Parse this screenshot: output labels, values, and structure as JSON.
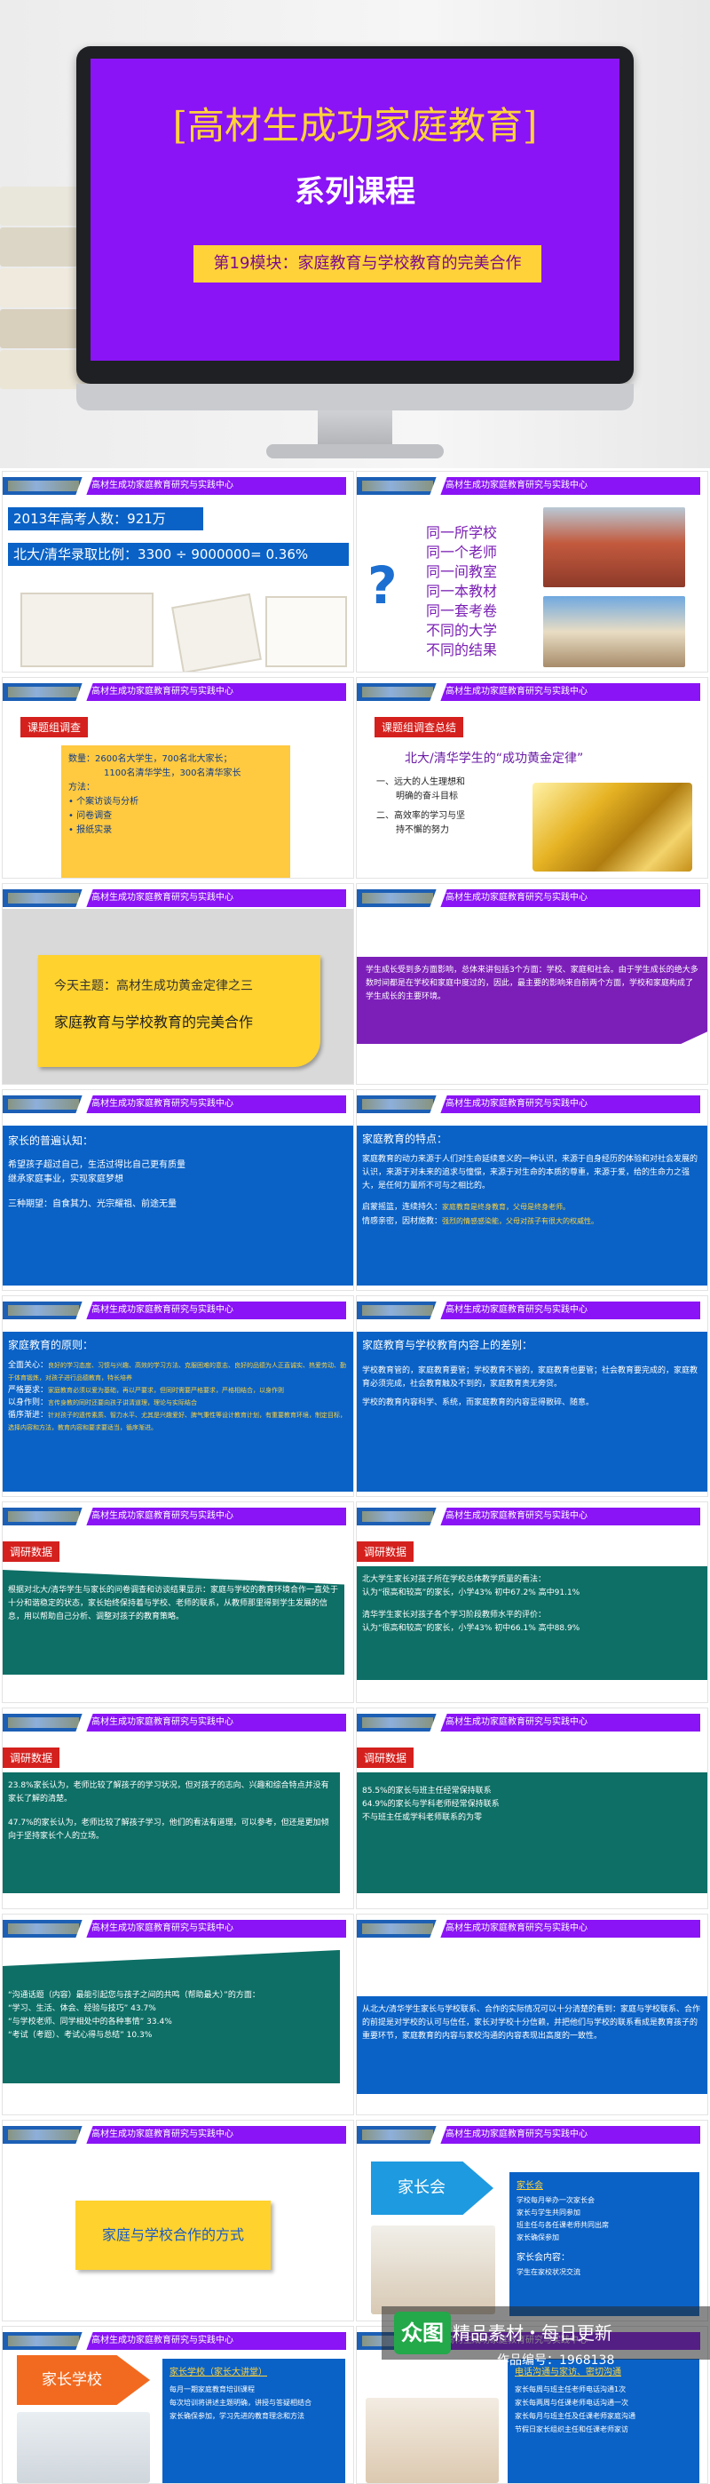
{
  "hero": {
    "title": "[高材生成功家庭教育]",
    "subtitle": "系列课程",
    "module": "第19模块：家庭教育与学校教育的完美合作"
  },
  "header_text": "高材生成功家庭教育研究与实践中心",
  "slide1": {
    "stat1": "2013年高考人数：921万",
    "stat2": "北大/清华录取比例：3300 ÷ 9000000= 0.36%"
  },
  "slide2": {
    "question_mark": "?",
    "lines": [
      "同一所学校",
      "同一个老师",
      "同一间教室",
      "同一本教材",
      "同一套考卷",
      "不同的大学",
      "不同的结果"
    ]
  },
  "slide3": {
    "tag": "课题组调查",
    "line1": "数量：2600名大学生，700名北大家长；",
    "line2": "1100名清华学生，300名清华家长",
    "method_label": "方法：",
    "methods": [
      "个案访谈与分析",
      "问卷调查",
      "报纸实录"
    ]
  },
  "slide4": {
    "tag": "课题组调查总结",
    "heading": "北大/清华学生的“成功黄金定律”",
    "item1_a": "一、远大的人生理想和",
    "item1_b": "明确的奋斗目标",
    "item2_a": "二、高效率的学习与坚",
    "item2_b": "持不懈的努力"
  },
  "slide5": {
    "line1": "今天主题：高材生成功黄金定律之三",
    "line2": "家庭教育与学校教育的完美合作"
  },
  "slide6": {
    "text": "学生成长受到多方面影响，总体来讲包括3个方面：学校、家庭和社会。由于学生成长的绝大多数时间都是在学校和家庭中度过的，因此，最主要的影响来自前两个方面，学校和家庭构成了学生成长的主要环境。"
  },
  "slide7": {
    "title": "家长的普遍认知：",
    "p1": "希望孩子超过自己，生活过得比自己更有质量",
    "p2": "继承家庭事业，实现家庭梦想",
    "p3": "三种期望：自食其力、光宗耀祖、前途无量"
  },
  "slide8": {
    "title": "家庭教育的特点：",
    "text": "家庭教育的动力来源于人们对生命延续意义的一种认识，来源于自身经历的体验和对社会发展的认识，来源于对未来的追求与憧憬，来源于对生命的本质的尊重，来源于爱，给的生命力之强大，是任何力量所不可与之相比的。",
    "k1_label": "启蒙摇篮，连续持久：",
    "k1_text": "家庭教育是终身教育，父母是终身老师。",
    "k2_label": "情感亲密，因材施教：",
    "k2_text": "强烈的情感感染能，父母对孩子有很大的权威性。"
  },
  "slide9": {
    "title": "家庭教育的原则：",
    "r1_label": "全面关心：",
    "r1_text": "良好的学习态度、习惯与兴趣、高效的学习方法、克服困难的意志、良好的品德为人正直诚实、热爱劳动、勤于体育锻炼，对孩子进行品德教育，特长培养",
    "r2_label": "严格要求：",
    "r2_text": "家庭教育必须以爱为基础，再以严要求，但同时需要严格要求，严格相结合，以身作则",
    "r3_label": "以身作则：",
    "r3_text": "言传身教的同时还要向孩子讲清道理，理论与实际结合",
    "r4_label": "循序渐进：",
    "r4_text": "针对孩子的遗传素质、智力水平、尤其是兴趣爱好、脾气秉性等设计教育计划，有重要教育环境，制定目标，选择内容和方法，教育内容和要求要适当，循序渐进。"
  },
  "slide10": {
    "title": "家庭教育与学校教育内容上的差别：",
    "p1": "学校教育管的，家庭教育要管；学校教育不管的，家庭教育也要管；社会教育要完成的，家庭教育必须完成，社会教育触及不到的，家庭教育责无旁贷。",
    "p2": "学校的教育内容科学、系统，而家庭教育的内容显得散碎、随意。"
  },
  "slide11": {
    "tag": "调研数据",
    "text": "根据对北大/清华学生与家长的问卷调查和访谈结果显示：家庭与学校的教育环境合作一直处于十分和谐稳定的状态，家长始终保持着与学校、老师的联系，从教师那里得到学生发展的信息，用以帮助自己分析、调整对孩子的教育策略。"
  },
  "slide12": {
    "tag": "调研数据",
    "p1": "北大学生家长对孩子所在学校总体教学质量的看法：",
    "p2": "认为“很高和较高”的家长，小学43% 初中67.2% 高中91.1%",
    "p3": "清华学生家长对孩子各个学习阶段教师水平的评价：",
    "p4": "认为“很高和较高”的家长，小学43% 初中66.1% 高中88.9%"
  },
  "slide13": {
    "tag": "调研数据",
    "p1": "23.8%家长认为，老师比较了解孩子的学习状况，但对孩子的志向、兴趣和综合特点并没有家长了解的清楚。",
    "p2": "47.7%的家长认为，老师比较了解孩子学习，他们的看法有道理，可以参考，但还是更加倾向于坚持家长个人的立场。"
  },
  "slide14": {
    "tag": "调研数据",
    "p1": "85.5%的家长与班主任经常保持联系",
    "p2": "64.9%的家长与学科老师经常保持联系",
    "p3": "不与班主任或学科老师联系的为零"
  },
  "slide15": {
    "p1": "“沟通话题（内容）最能引起您与孩子之间的共鸣（帮助最大）”的方面：",
    "p2": "“学习、生活、体会、经验与技巧” 43.7%",
    "p3": "“与学校老师、同学相处中的各种事情” 33.4%",
    "p4": "“考试（考题）、考试心得与总结” 10.3%"
  },
  "slide16": {
    "text": "从北大/清华学生家长与学校联系、合作的实际情况可以十分清楚的看到：家庭与学校联系、合作的前提是对学校的认可与信任，家长对学校十分信赖，并把他们与学校的联系看成是教育孩子的重要环节，家庭教育的内容与家校沟通的内容表现出高度的一致性。"
  },
  "slide17": {
    "text": "家庭与学校合作的方式"
  },
  "slide18": {
    "arrow": "家长会",
    "title": "家长会",
    "items": [
      "学校每月举办一次家长会",
      "家长与学生共同参加",
      "班主任与各任课老师共同出席",
      "家长确保参加"
    ],
    "title2": "家长会内容：",
    "item5": "学生在家校状况交流"
  },
  "slide19": {
    "arrow": "家长学校",
    "title": "家长学校（家长大讲堂）",
    "items": [
      "每月一期家庭教育培训课程",
      "每次培训将讲述主题明确，讲授与答疑相结合",
      "家长确保参加，学习先进的教育理念和方法"
    ]
  },
  "slide20": {
    "title": "电话沟通与家访、密切沟通",
    "items": [
      "家长每周与班主任老师电话沟通1次",
      "家长每两周与任课老师电话沟通一次",
      "家长每月与班主任及任课老师家庭沟通",
      "节假日家长组织主任和任课老师家访"
    ]
  },
  "watermark": {
    "logo": "众图",
    "text": "精品素材・每日更新",
    "id": "作品编号：1968138"
  }
}
